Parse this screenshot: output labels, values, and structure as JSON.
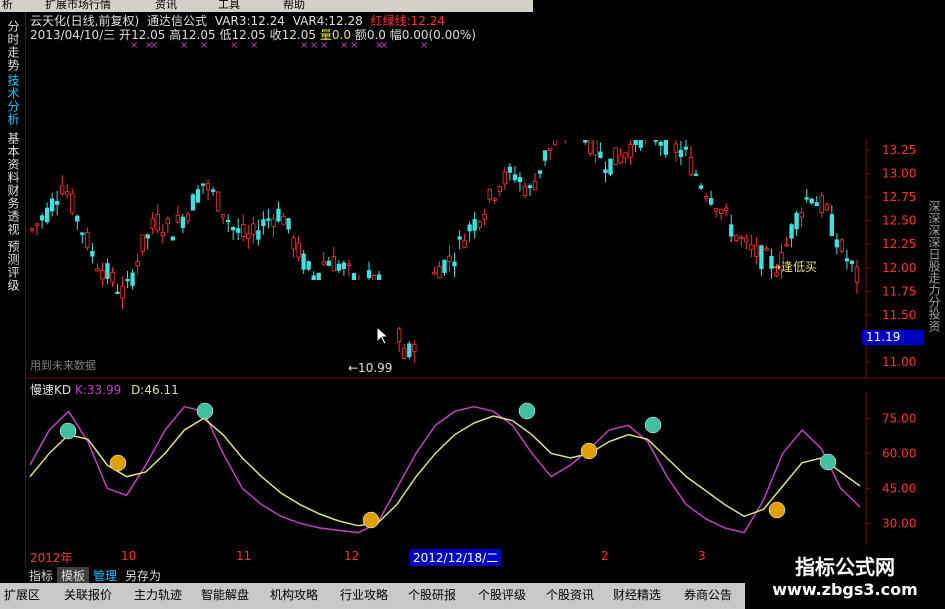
{
  "menu": [
    "析",
    "扩展市场行情",
    "资讯",
    "工具",
    "帮助"
  ],
  "sidebar": [
    {
      "label": "分时走势",
      "active": false
    },
    {
      "label": "技术分析",
      "active": true
    },
    {
      "label": "基本资料",
      "active": false
    },
    {
      "label": "财务透视",
      "active": false
    },
    {
      "label": "预测评级",
      "active": false
    }
  ],
  "title": {
    "stock": "云天化(日线,前复权)",
    "formula": "通达信公式",
    "var3_label": "VAR3:",
    "var3_value": "12.24",
    "var4_label": "VAR4:",
    "var4_value": "12.28",
    "redgreen_label": "红绿线:",
    "redgreen_value": "12.24"
  },
  "info_bar": {
    "date": "2013/04/10/三",
    "open_label": "开",
    "open": "12.05",
    "high_label": "高",
    "high": "12.05",
    "low_label": "低",
    "low": "12.05",
    "close_label": "收",
    "close": "12.05",
    "vol_label": "量",
    "vol": "0.0",
    "amt_label": "额",
    "amt": "0.0",
    "range_label": "幅",
    "range": "0.00(0.00%)"
  },
  "main_chart": {
    "price_ticks": [
      "13.25",
      "13.00",
      "12.75",
      "12.50",
      "12.25",
      "12.00",
      "11.75",
      "11.50",
      "11.25",
      "11.00"
    ],
    "current_price": "11.19",
    "low_label": "←10.99",
    "future_data_note": "用到未来数据",
    "signal_label": "→逢低买"
  },
  "side_text": "深深深深日股走力分投资",
  "kd_panel": {
    "name": "慢速KD",
    "k_label": "K:",
    "k_value": "33.99",
    "d_label": "D:",
    "d_value": "46.11",
    "ticks": [
      "75.00",
      "60.00",
      "45.00",
      "30.00"
    ]
  },
  "time_axis": {
    "labels": [
      "2012年",
      "10",
      "11",
      "12",
      "2",
      "3"
    ],
    "cursor_date": "2012/12/18/二"
  },
  "tabs": [
    {
      "label": "指标",
      "active": false
    },
    {
      "label": "模板",
      "active": true
    },
    {
      "label": "管理",
      "active": false
    },
    {
      "label": "另存为",
      "active": false
    }
  ],
  "functions": [
    "扩展区",
    "关联报价",
    "主力轨迹",
    "智能解盘",
    "机构攻略",
    "行业攻略",
    "个股研报",
    "个股评级",
    "个股资讯",
    "财经精选",
    "券商公告"
  ],
  "watermark": {
    "line1": "指标公式网",
    "line2": "www.zbgs3.com"
  },
  "colors": {
    "up": "#ff3030",
    "down": "#40e0e0",
    "k_line": "#c040c0",
    "d_line": "#e0e080",
    "grid": "#800000",
    "accent": "#00c8ff"
  }
}
